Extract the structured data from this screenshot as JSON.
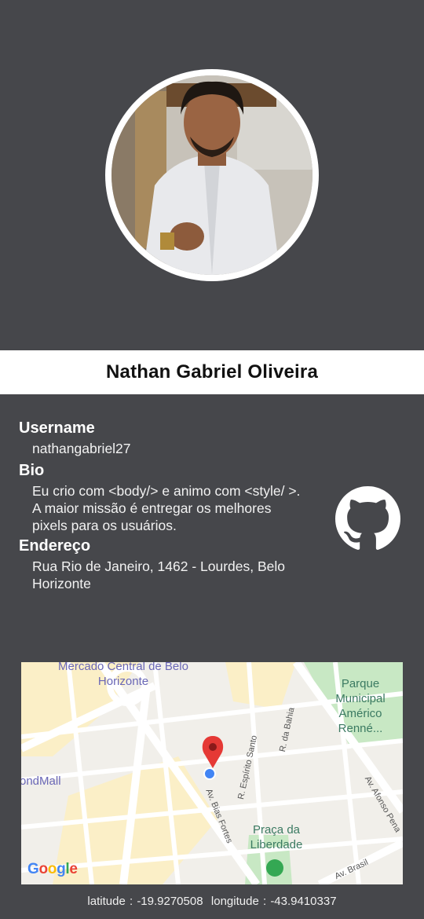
{
  "profile": {
    "name": "Nathan Gabriel Oliveira",
    "photo_alt": "avatar"
  },
  "info": {
    "username_label": "Username",
    "username": "nathangabriel27",
    "bio_label": "Bio",
    "bio_line1": "Eu crio com <body/> e animo com <style/ >.",
    "bio_line2": "A maior missão é entregar os melhores pixels para os usuários.",
    "address_label": "Endereço",
    "address": "Rua Rio de Janeiro, 1462 - Lourdes, Belo Horizonte"
  },
  "github": {
    "icon": "github-icon"
  },
  "map": {
    "places": {
      "mercado": "Mercado Central de Belo Horizonte",
      "parque": "Parque Municipal Américo Renné...",
      "mall": "ondMall",
      "praca": "Praça da Liberdade"
    },
    "streets": {
      "bias": "Av. Bias Fortes",
      "espirito": "R. Espírito Santo",
      "bahia": "R. da Bahia",
      "afonso": "Av. Afonso Pena",
      "brasil": "Av. Brasil"
    },
    "provider": "Google"
  },
  "location": {
    "latitude_label": "latitude :",
    "latitude": "-19.9270508",
    "longitude_label": "longitude :",
    "longitude": "-43.9410337"
  },
  "colors": {
    "background": "#46474b",
    "name_bar": "#ffffff",
    "pin": "#e53935",
    "user_dot": "#4285f4"
  }
}
